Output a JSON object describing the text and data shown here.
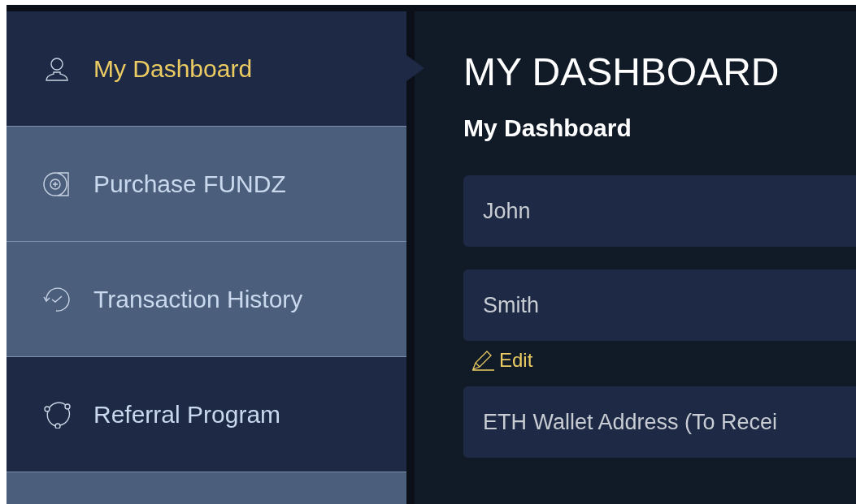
{
  "sidebar": {
    "items": [
      {
        "label": "My Dashboard",
        "selected": true,
        "kind": "dark"
      },
      {
        "label": "Purchase FUNDZ",
        "selected": false,
        "kind": "light"
      },
      {
        "label": "Transaction History",
        "selected": false,
        "kind": "light"
      },
      {
        "label": "Referral Program",
        "selected": false,
        "kind": "dark"
      }
    ]
  },
  "main": {
    "title": "MY DASHBOARD",
    "subtitle": "My Dashboard",
    "fields": [
      {
        "value": "John"
      },
      {
        "value": "Smith",
        "edit_link": "Edit"
      },
      {
        "placeholder": "ETH Wallet Address (To Recei"
      }
    ]
  }
}
